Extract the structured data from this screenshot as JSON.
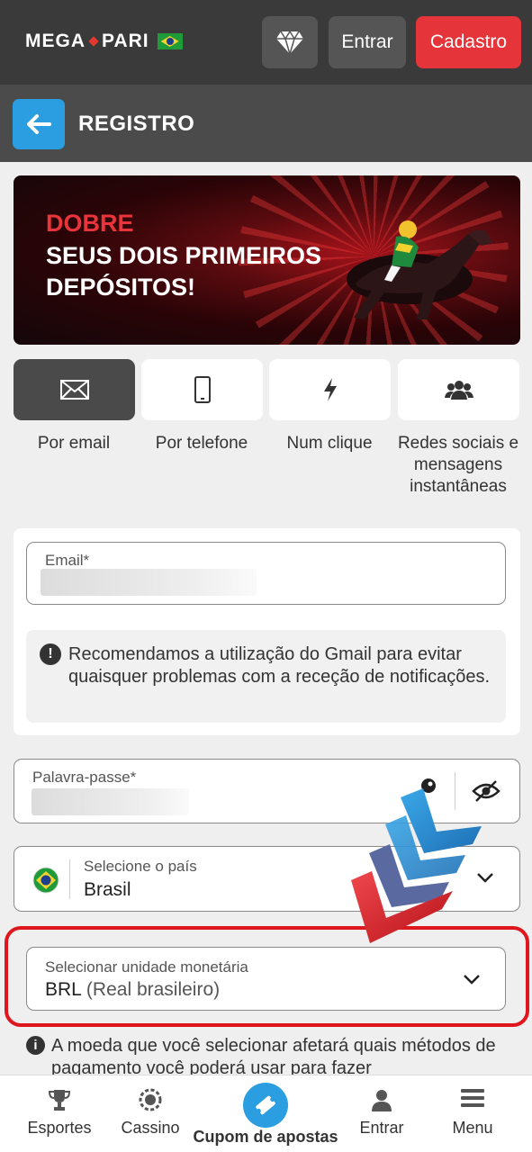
{
  "header": {
    "logo_left": "MEGA",
    "logo_right": "PARI",
    "login_label": "Entrar",
    "register_label": "Cadastro",
    "icons": {
      "gem": "diamond-icon",
      "flag": "brazil-flag-icon"
    }
  },
  "titlebar": {
    "title": "REGISTRO",
    "back_icon": "arrow-left-icon"
  },
  "banner": {
    "headline": "DOBRE",
    "subline": "SEUS DOIS PRIMEIROS DEPÓSITOS!"
  },
  "tabs": [
    {
      "label": "Por email",
      "icon": "envelope-icon",
      "active": true
    },
    {
      "label": "Por telefone",
      "icon": "phone-icon",
      "active": false
    },
    {
      "label": "Num clique",
      "icon": "lightning-icon",
      "active": false
    },
    {
      "label": "Redes sociais e mensagens instantâneas",
      "icon": "users-icon",
      "active": false
    }
  ],
  "form": {
    "email_label": "Email*",
    "gmail_notice": "Recomendamos a utilização do Gmail para evitar quaisquer problemas com a receção de notificações.",
    "password_label": "Palavra-passe*",
    "country_label": "Selecione o país",
    "country_value": "Brasil",
    "currency_label": "Selecionar unidade monetária",
    "currency_code": "BRL",
    "currency_name": "(Real brasileiro)",
    "currency_notice": "A moeda que você selecionar afetará quais métodos de pagamento você poderá usar para fazer"
  },
  "bottom_nav": [
    {
      "label": "Esportes",
      "icon": "trophy-icon"
    },
    {
      "label": "Cassino",
      "icon": "casino-chip-icon"
    },
    {
      "label": "Cupom de apostas",
      "icon": "ticket-icon"
    },
    {
      "label": "Entrar",
      "icon": "user-icon"
    },
    {
      "label": "Menu",
      "icon": "hamburger-menu-icon"
    }
  ],
  "colors": {
    "accent_blue": "#2a9ee0",
    "accent_red": "#e5343a",
    "header_bg": "#3a3a3a"
  }
}
